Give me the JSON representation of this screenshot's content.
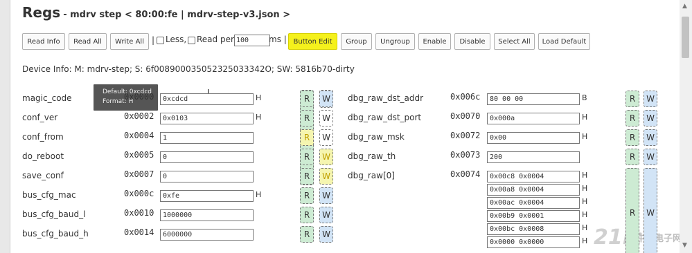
{
  "title": "Regs",
  "subtitle": "- mdrv step < 80:00:fe | mdrv-step-v3.json >",
  "toolbar": {
    "read_info": "Read Info",
    "read_all": "Read All",
    "write_all": "Write All",
    "sep1": "|",
    "less_label": "Less,",
    "less_checked": false,
    "read_per_label": "Read per",
    "read_per_checked": false,
    "read_per_value": "100",
    "ms_label": "ms |",
    "button_edit": "Button Edit",
    "group": "Group",
    "ungroup": "Ungroup",
    "enable": "Enable",
    "disable": "Disable",
    "select_all": "Select All",
    "load_default": "Load Default"
  },
  "device_info": "Device Info: M: mdrv-step; S: 6f008900035052325033342O; SW: 5816b70-dirty",
  "tooltip": {
    "line1": "Default: 0xcdcd",
    "line2": "Format: H"
  },
  "left_regs": [
    {
      "name": "magic_code",
      "addr": "0x0000",
      "value": "0xcdcd",
      "unit": "H"
    },
    {
      "name": "conf_ver",
      "addr": "0x0002",
      "value": "0x0103",
      "unit": "H"
    },
    {
      "name": "conf_from",
      "addr": "0x0004",
      "value": "1",
      "unit": ""
    },
    {
      "name": "do_reboot",
      "addr": "0x0005",
      "value": "0",
      "unit": ""
    },
    {
      "name": "save_conf",
      "addr": "0x0007",
      "value": "0",
      "unit": ""
    },
    {
      "name": "bus_cfg_mac",
      "addr": "0x000c",
      "value": "0xfe",
      "unit": "H"
    },
    {
      "name": "bus_cfg_baud_l",
      "addr": "0x0010",
      "value": "1000000",
      "unit": ""
    },
    {
      "name": "bus_cfg_baud_h",
      "addr": "0x0014",
      "value": "6000000",
      "unit": ""
    }
  ],
  "right_regs": [
    {
      "name": "dbg_raw_dst_addr",
      "addr": "0x006c",
      "value": "80 00 00",
      "unit": "B"
    },
    {
      "name": "dbg_raw_dst_port",
      "addr": "0x0070",
      "value": "0x000a",
      "unit": "H"
    },
    {
      "name": "dbg_raw_msk",
      "addr": "0x0072",
      "value": "0x00",
      "unit": "H"
    },
    {
      "name": "dbg_raw_th",
      "addr": "0x0073",
      "value": "200",
      "unit": ""
    },
    {
      "name": "dbg_raw[0]",
      "addr": "0x0074",
      "value": "0x00c8 0x0004",
      "unit": "H"
    }
  ],
  "dbg_raw_extra": [
    {
      "value": "0x00a8 0x0004",
      "unit": "H"
    },
    {
      "value": "0x00ac 0x0004",
      "unit": "H"
    },
    {
      "value": "0x00b9 0x0001",
      "unit": "H"
    },
    {
      "value": "0x00bc 0x0008",
      "unit": "H"
    },
    {
      "value": "0x0000 0x0000",
      "unit": "H"
    }
  ],
  "rw": {
    "r": "R",
    "w": "W"
  },
  "watermark": "21ic",
  "watermark_sub": "中国电子网"
}
